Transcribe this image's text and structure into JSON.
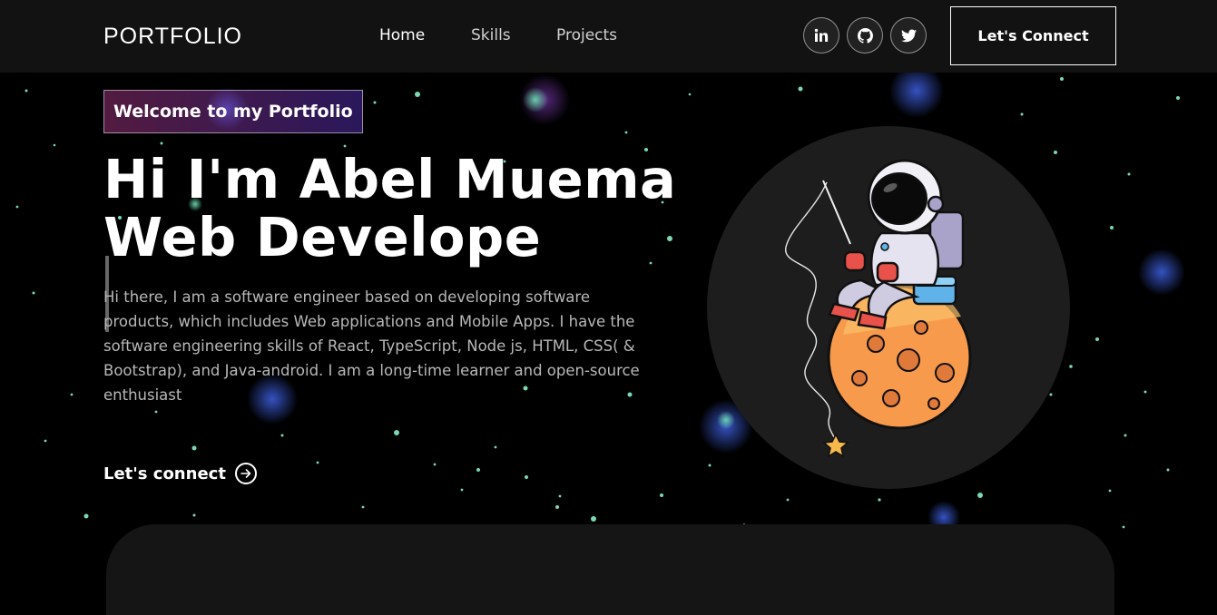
{
  "navbar": {
    "logo": "PORTFOLIO",
    "links": [
      {
        "label": "Home"
      },
      {
        "label": "Skills"
      },
      {
        "label": "Projects"
      }
    ],
    "social_icons": [
      "linkedin-icon",
      "github-icon",
      "twitter-icon"
    ],
    "connect_button": "Let's Connect"
  },
  "hero": {
    "tagline": "Welcome to my Portfolio",
    "title_line1": "Hi I'm Abel Muema",
    "title_line2": "Web Develope",
    "description": "Hi there, I am a software engineer based on developing software products, which includes Web applications and Mobile Apps. I have the software engineering skills of React, TypeScript, Node js, HTML, CSS( & Bootstrap), and Java-android. I am a long-time learner and open-source enthusiast",
    "cta_label": "Let's connect",
    "cta_icon": "arrow-right-circle-icon",
    "illustration": "astronaut-fishing-on-moon"
  },
  "colors": {
    "background": "#000000",
    "navbar": "#121212",
    "tagline_gradient_start": "#AA367C",
    "tagline_gradient_end": "#4A2FBD",
    "description_text": "#B8B8B8",
    "image_circle": "#1D1D1D",
    "bottom_panel": "#151515"
  }
}
